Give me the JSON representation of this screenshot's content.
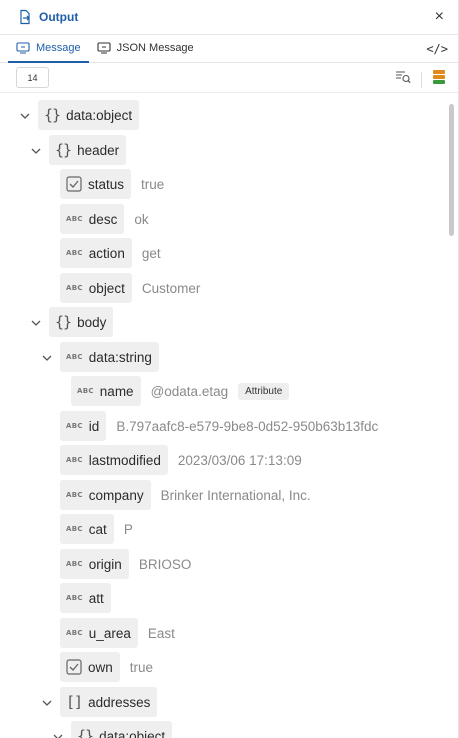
{
  "header": {
    "title": "Output",
    "close_glyph": "×"
  },
  "tabs": [
    {
      "label": "Message",
      "active": true
    },
    {
      "label": "JSON Message",
      "active": false
    }
  ],
  "toolbar": {
    "depth": "14"
  },
  "colors": {
    "accent": "#1f5fa8",
    "pill_bg": "#efefef",
    "value_text": "#8a8a8a",
    "layer_orange": "#e08a1e",
    "layer_green": "#3a9a3a"
  },
  "tree": {
    "root": {
      "key": "data:object"
    },
    "header": {
      "key": "header"
    },
    "status": {
      "key": "status",
      "value": "true"
    },
    "desc": {
      "key": "desc",
      "value": "ok"
    },
    "action": {
      "key": "action",
      "value": "get"
    },
    "object": {
      "key": "object",
      "value": "Customer"
    },
    "body": {
      "key": "body"
    },
    "data_string": {
      "key": "data:string"
    },
    "name": {
      "key": "name",
      "value": "@odata.etag",
      "badge": "Attribute"
    },
    "id": {
      "key": "id",
      "value": "B.797aafc8-e579-9be8-0d52-950b63b13fdc"
    },
    "lastmodified": {
      "key": "lastmodified",
      "value": "2023/03/06 17:13:09"
    },
    "company": {
      "key": "company",
      "value": "Brinker International, Inc."
    },
    "cat": {
      "key": "cat",
      "value": "P"
    },
    "origin": {
      "key": "origin",
      "value": "BRIOSO"
    },
    "att": {
      "key": "att",
      "value": ""
    },
    "u_area": {
      "key": "u_area",
      "value": "East"
    },
    "own": {
      "key": "own",
      "value": "true"
    },
    "addresses": {
      "key": "addresses"
    },
    "addr_obj": {
      "key": "data:object"
    }
  },
  "type_labels": {
    "string": "ABC"
  }
}
